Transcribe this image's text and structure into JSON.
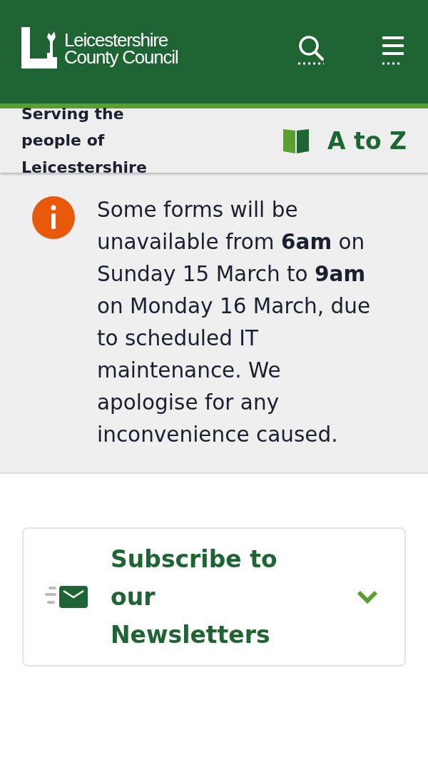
{
  "header": {
    "logo_lines": [
      "Leicestershire",
      "County Council"
    ]
  },
  "subbar": {
    "tagline": "Serving the people of Leicestershire",
    "a_to_z": "A to Z"
  },
  "alert": {
    "message": "Some forms will be unavailable from **6am** on Sunday 15 March to **9am** on Monday 16 March, due to scheduled IT maintenance. We apologise for any inconvenience caused."
  },
  "newsletter": {
    "title": "Subscribe to our Newsletters",
    "expanded": false
  }
}
